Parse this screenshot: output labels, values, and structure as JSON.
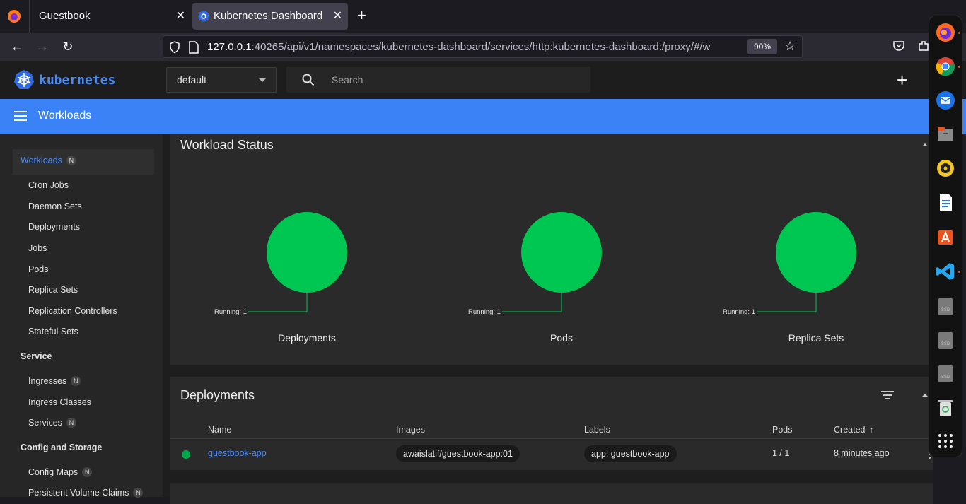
{
  "browser": {
    "tabs": [
      {
        "title": "Guestbook"
      },
      {
        "title": "Kubernetes Dashboard"
      }
    ],
    "url_host": "127.0.0.1",
    "url_rest": ":40265/api/v1/namespaces/kubernetes-dashboard/services/http:kubernetes-dashboard:/proxy/#/w",
    "zoom": "90%"
  },
  "header": {
    "brand": "kubernetes",
    "namespace": "default",
    "search_placeholder": "Search"
  },
  "toolbar": {
    "title": "Workloads"
  },
  "sidebar": {
    "workloads": {
      "label": "Workloads",
      "badge": "N"
    },
    "workload_items": [
      "Cron Jobs",
      "Daemon Sets",
      "Deployments",
      "Jobs",
      "Pods",
      "Replica Sets",
      "Replication Controllers",
      "Stateful Sets"
    ],
    "service_heading": "Service",
    "service_items": [
      {
        "label": "Ingresses",
        "badge": "N"
      },
      {
        "label": "Ingress Classes",
        "badge": ""
      },
      {
        "label": "Services",
        "badge": "N"
      }
    ],
    "config_heading": "Config and Storage",
    "config_items": [
      {
        "label": "Config Maps",
        "badge": "N"
      },
      {
        "label": "Persistent Volume Claims",
        "badge": "N"
      }
    ]
  },
  "workload_status": {
    "title": "Workload Status",
    "charts": [
      {
        "label": "Deployments",
        "running_label": "Running: 1",
        "running": 1
      },
      {
        "label": "Pods",
        "running_label": "Running: 1",
        "running": 1
      },
      {
        "label": "Replica Sets",
        "running_label": "Running: 1",
        "running": 1
      }
    ],
    "running_color": "#00c752"
  },
  "deployments": {
    "title": "Deployments",
    "columns": {
      "name": "Name",
      "images": "Images",
      "labels": "Labels",
      "pods": "Pods",
      "created": "Created"
    },
    "rows": [
      {
        "name": "guestbook-app",
        "image": "awaislatif/guestbook-app:01",
        "label": "app: guestbook-app",
        "pods": "1 / 1",
        "created": "8 minutes ago",
        "status_color": "#00a84a"
      }
    ]
  },
  "dock": {
    "apps": [
      "firefox-icon",
      "chrome-icon",
      "thunderbird-icon",
      "files-icon",
      "rhythmbox-icon",
      "writer-icon",
      "app-center-icon",
      "vscode-icon",
      "ssd-drive-icon",
      "ssd-drive-icon",
      "ssd-drive-icon",
      "trash-icon",
      "app-grid-icon"
    ]
  }
}
